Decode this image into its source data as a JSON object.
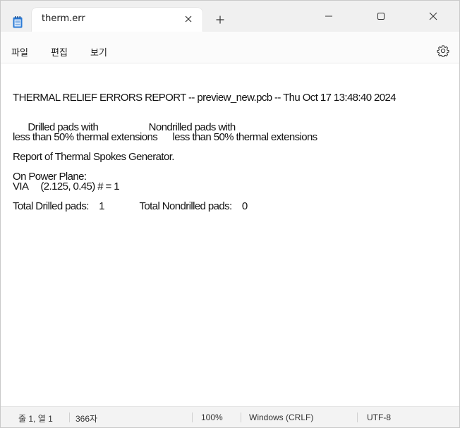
{
  "window": {
    "tab_title": "therm.err"
  },
  "menu": {
    "file": "파일",
    "edit": "편집",
    "view": "보기"
  },
  "content": {
    "lines": [
      "THERMAL RELIEF ERRORS REPORT -- preview_new.pcb -- Thu Oct 17 13:48:40 2024",
      "      Drilled pads with                    Nondrilled pads with",
      "less than 50% thermal extensions      less than 50% thermal extensions",
      "Report of Thermal Spokes Generator.",
      "On Power Plane:",
      "VIA     (2.125, 0.45) # = 1",
      "Total Drilled pads:    1              Total Nondrilled pads:    0"
    ]
  },
  "status": {
    "position": "줄 1, 열 1",
    "chars": "366자",
    "zoom": "100%",
    "line_ending": "Windows (CRLF)",
    "encoding": "UTF-8"
  },
  "icons": {
    "app": "notepad-icon",
    "close_tab": "close-icon",
    "new_tab": "plus-icon",
    "minimize": "minimize-icon",
    "maximize": "maximize-icon",
    "close_window": "close-icon",
    "settings": "gear-icon"
  },
  "colors": {
    "accent": "#1e6fd0",
    "titlebar": "#f0f0f0",
    "statusbar": "#f3f3f3"
  }
}
